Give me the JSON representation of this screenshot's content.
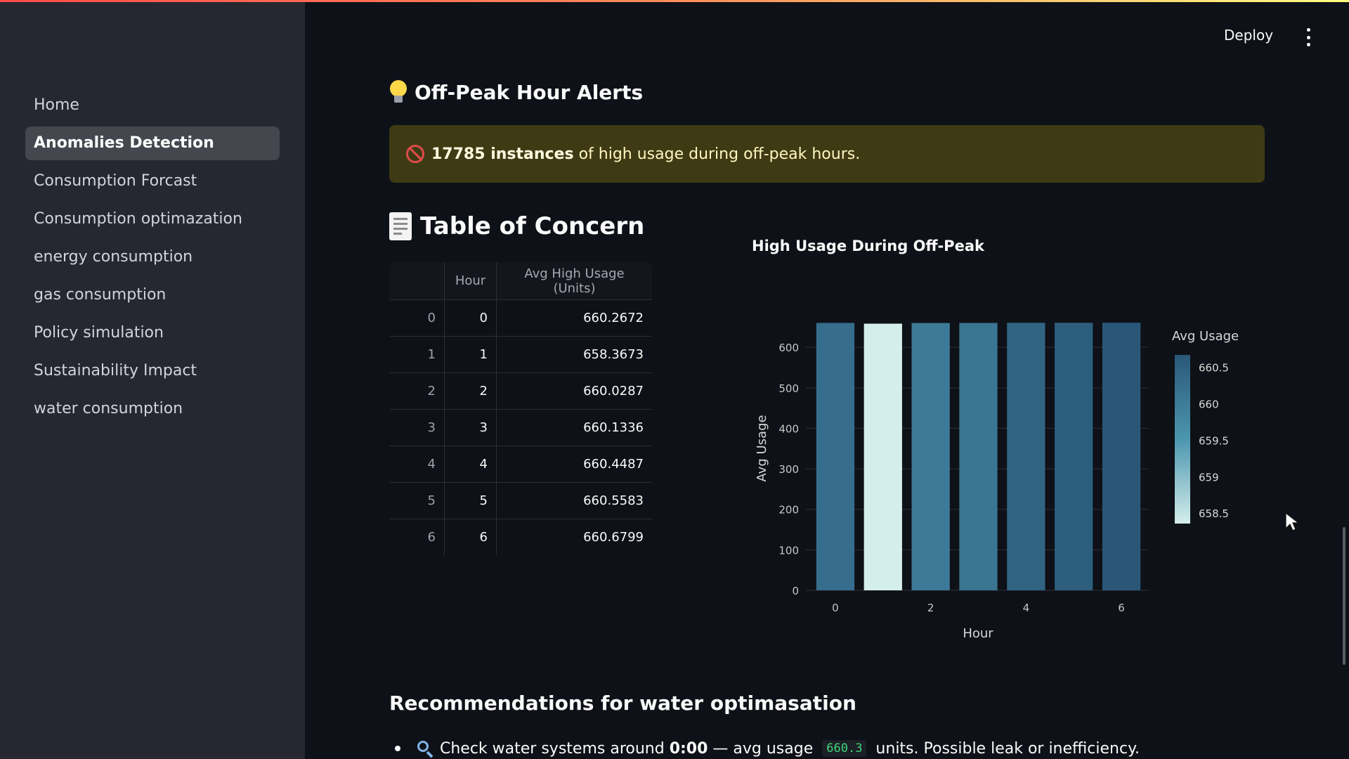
{
  "header": {
    "deploy_label": "Deploy",
    "menu_icon": "vertical-dots-icon"
  },
  "sidebar": {
    "items": [
      {
        "label": "Home",
        "active": false
      },
      {
        "label": "Anomalies Detection",
        "active": true
      },
      {
        "label": "Consumption Forcast",
        "active": false
      },
      {
        "label": "Consumption optimazation",
        "active": false
      },
      {
        "label": "energy consumption",
        "active": false
      },
      {
        "label": "gas consumption",
        "active": false
      },
      {
        "label": "Policy simulation",
        "active": false
      },
      {
        "label": "Sustainability Impact",
        "active": false
      },
      {
        "label": "water consumption",
        "active": false
      }
    ]
  },
  "alerts": {
    "heading": "Off-Peak Hour Alerts",
    "icon": "lightbulb-icon",
    "message_bold": "17785 instances",
    "message_rest": " of high usage during off-peak hours.",
    "message_icon": "no-entry-icon"
  },
  "concern_table": {
    "heading": "Table of Concern",
    "icon": "receipt-icon",
    "columns": [
      "",
      "Hour",
      "Avg High Usage (Units)"
    ],
    "rows": [
      [
        "0",
        "0",
        "660.2672"
      ],
      [
        "1",
        "1",
        "658.3673"
      ],
      [
        "2",
        "2",
        "660.0287"
      ],
      [
        "3",
        "3",
        "660.1336"
      ],
      [
        "4",
        "4",
        "660.4487"
      ],
      [
        "5",
        "5",
        "660.5583"
      ],
      [
        "6",
        "6",
        "660.6799"
      ]
    ]
  },
  "chart_data": {
    "type": "bar",
    "title": "High Usage During Off-Peak",
    "xlabel": "Hour",
    "ylabel": "Avg Usage",
    "categories": [
      0,
      1,
      2,
      3,
      4,
      5,
      6
    ],
    "values": [
      660.2672,
      658.3673,
      660.0287,
      660.1336,
      660.4487,
      660.5583,
      660.6799
    ],
    "x_ticks": [
      0,
      2,
      4,
      6
    ],
    "y_ticks": [
      0,
      100,
      200,
      300,
      400,
      500,
      600
    ],
    "ylim": [
      0,
      694
    ],
    "grid": true,
    "colorbar": {
      "title": "Avg Usage",
      "ticks": [
        658.5,
        659,
        659.5,
        660,
        660.5
      ],
      "range": [
        658.3673,
        660.6799
      ],
      "color_low": "#d4eeeb",
      "color_high": "#2a5778",
      "position": "right"
    }
  },
  "recommendations": {
    "heading": "Recommendations for water optimasation",
    "items": [
      {
        "icon": "magnifier-icon",
        "pre": "Check water systems around ",
        "bold": "0:00",
        "mid": " — avg usage ",
        "code": "660.3",
        "post": " units. Possible leak or inefficiency."
      }
    ]
  }
}
